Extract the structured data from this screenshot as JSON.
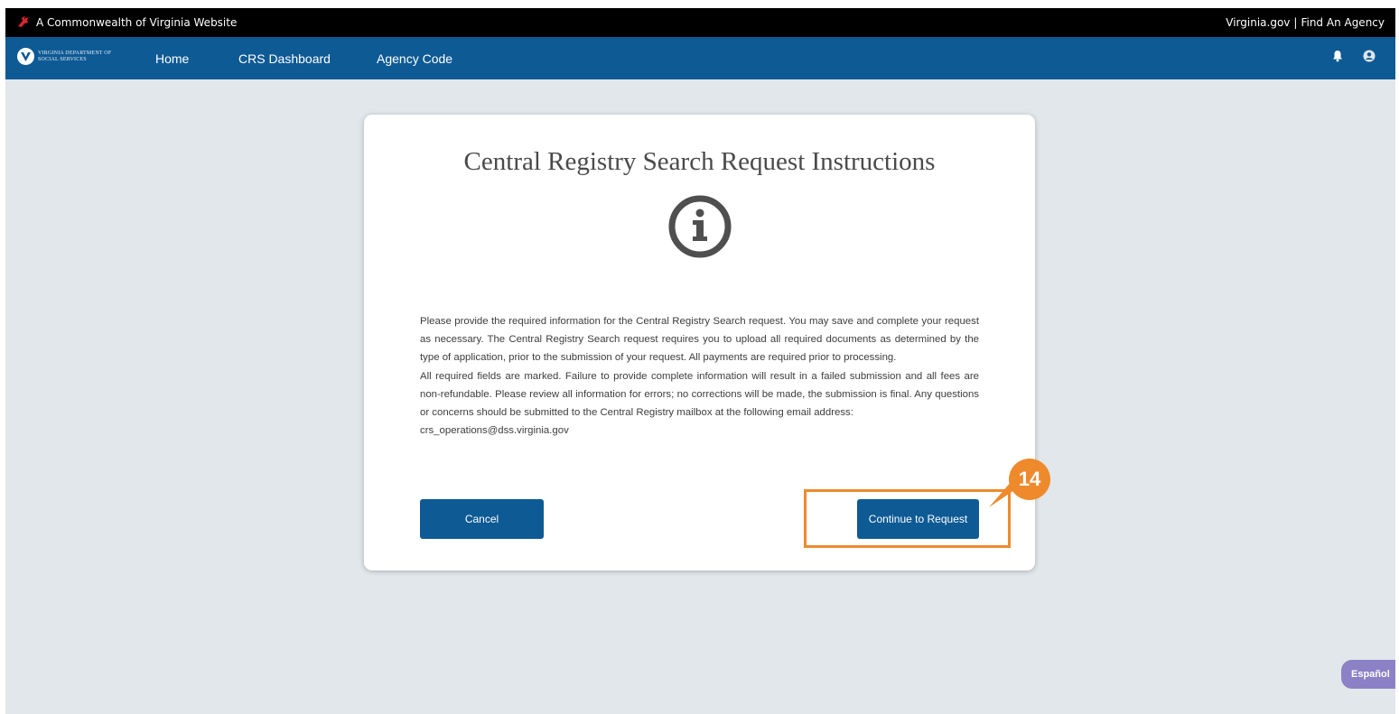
{
  "top_bar": {
    "brand_text": "A Commonwealth of Virginia Website",
    "link_virginia": "Virginia.gov",
    "separator": "|",
    "link_find_agency": "Find An Agency"
  },
  "nav": {
    "logo_line1": "VIRGINIA DEPARTMENT OF",
    "logo_line2": "SOCIAL SERVICES",
    "items": [
      {
        "label": "Home"
      },
      {
        "label": "CRS Dashboard"
      },
      {
        "label": "Agency Code"
      }
    ],
    "icons": [
      "bell-icon",
      "user-avatar-icon"
    ]
  },
  "card": {
    "title": "Central Registry Search Request Instructions",
    "icon": "info-icon",
    "paragraph1": "Please provide the required information for the Central Registry Search request. You may save and complete your request as necessary. The Central Registry Search request requires you to upload all required documents as determined by the type of application, prior to the submission of your request. All payments are required prior to processing.",
    "paragraph2": "All required fields are marked. Failure to provide complete information will result in a failed submission and all fees are non-refundable. Please review all information for errors; no corrections will be made, the submission is final. Any questions or concerns should be submitted to the Central Registry mailbox at the following email address:",
    "email": "crs_operations@dss.virginia.gov",
    "cancel_label": "Cancel",
    "continue_label": "Continue to Request"
  },
  "annotation": {
    "step_number": "14",
    "color": "#ee8a2c"
  },
  "language_button": "Español",
  "colors": {
    "nav_blue": "#0e5a94",
    "background": "#e1e7eb",
    "espanol_purple": "#8c80c6"
  }
}
